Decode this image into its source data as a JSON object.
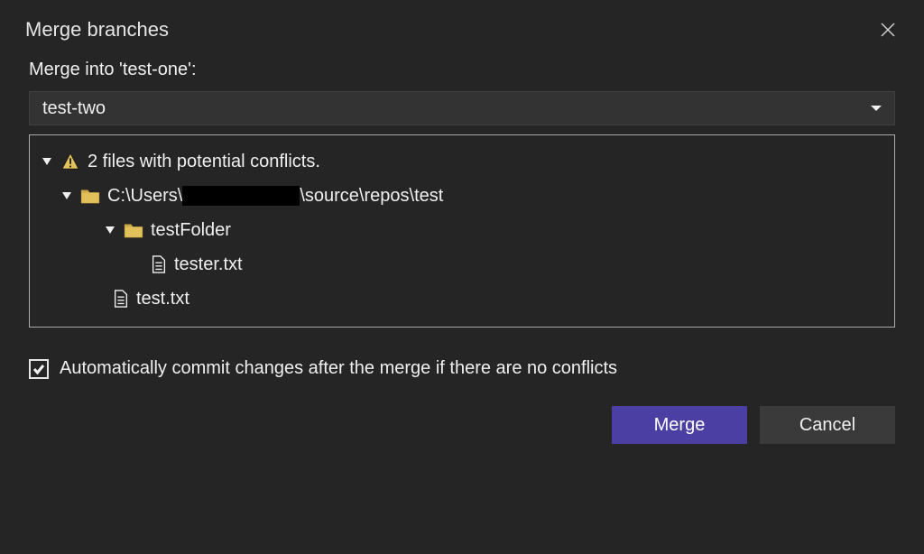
{
  "dialog": {
    "title": "Merge branches",
    "mergeIntoLabel": "Merge into 'test-one':",
    "selectedBranch": "test-two",
    "conflictHeader": "2 files with potential conflicts.",
    "repoPathPre": "C:\\Users\\",
    "repoPathPost": "\\source\\repos\\test",
    "tree": {
      "folder1": "testFolder",
      "file1": "tester.txt",
      "file2": "test.txt"
    },
    "autoCommitLabel": "Automatically commit changes after the merge if there are no conflicts",
    "autoCommitChecked": true,
    "buttons": {
      "merge": "Merge",
      "cancel": "Cancel"
    }
  }
}
